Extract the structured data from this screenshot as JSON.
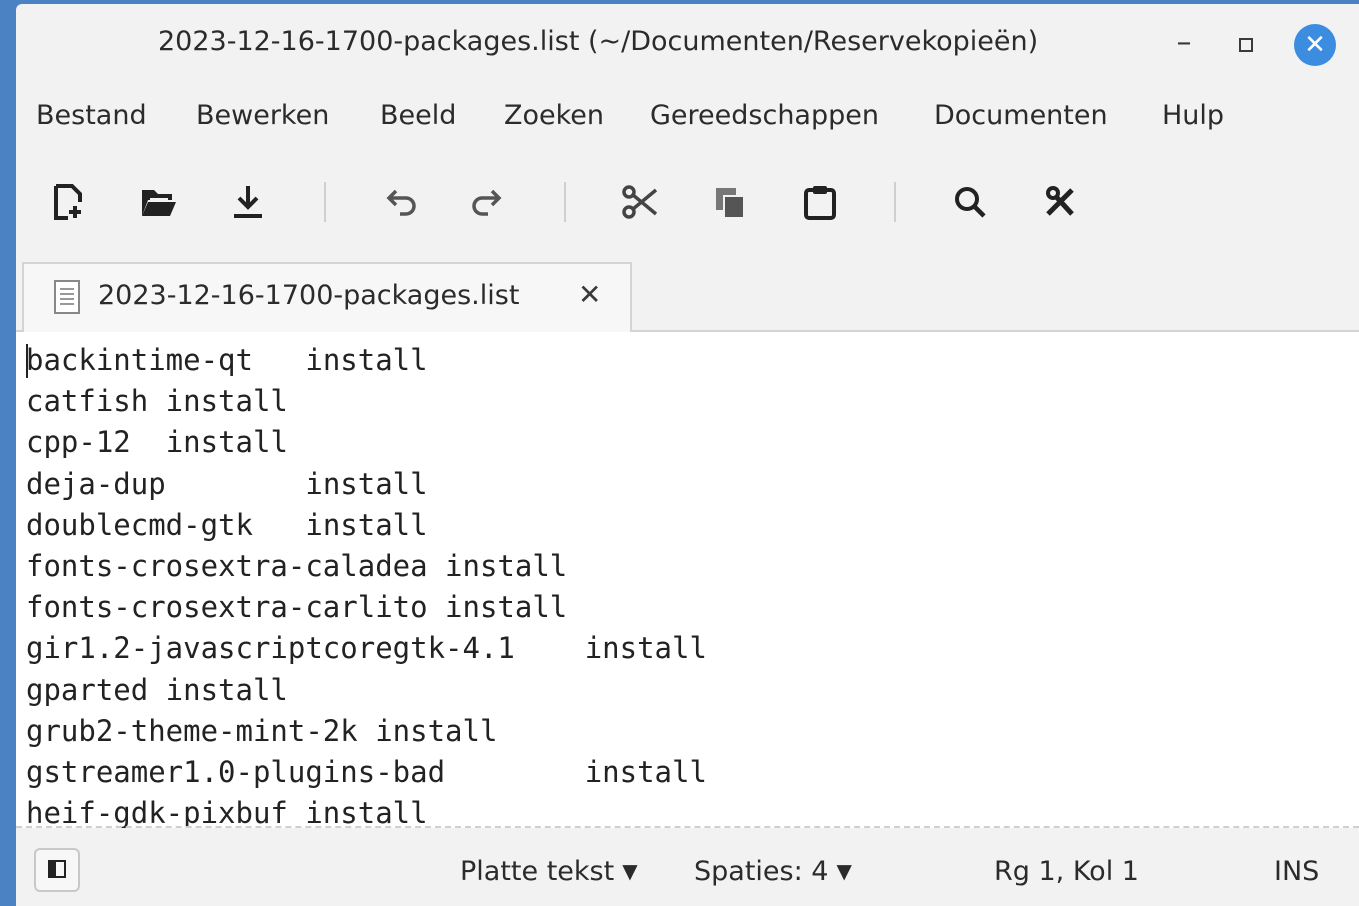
{
  "window": {
    "title": "2023-12-16-1700-packages.list (~/Documenten/Reservekopieën)",
    "minimize_glyph": "–",
    "close_glyph": "✕"
  },
  "menu": [
    "Bestand",
    "Bewerken",
    "Beeld",
    "Zoeken",
    "Gereedschappen",
    "Documenten",
    "Hulp"
  ],
  "toolbar": {
    "icons": [
      "new-document-icon",
      "open-document-icon",
      "save-icon",
      "undo-icon",
      "redo-icon",
      "cut-icon",
      "copy-icon",
      "paste-icon",
      "search-icon",
      "tools-icon"
    ]
  },
  "tab": {
    "label": "2023-12-16-1700-packages.list",
    "close_glyph": "✕"
  },
  "editor": {
    "lines": [
      "backintime-qt\tinstall",
      "catfish install",
      "cpp-12\tinstall",
      "deja-dup\tinstall",
      "doublecmd-gtk\tinstall",
      "fonts-crosextra-caladea install",
      "fonts-crosextra-carlito install",
      "gir1.2-javascriptcoregtk-4.1\tinstall",
      "gparted install",
      "grub2-theme-mint-2k install",
      "gstreamer1.0-plugins-bad\tinstall",
      "heif-gdk-pixbuf install"
    ]
  },
  "status": {
    "language": "Platte tekst",
    "spaces": "Spaties: 4",
    "position": "Rg 1, Kol 1",
    "mode": "INS"
  }
}
